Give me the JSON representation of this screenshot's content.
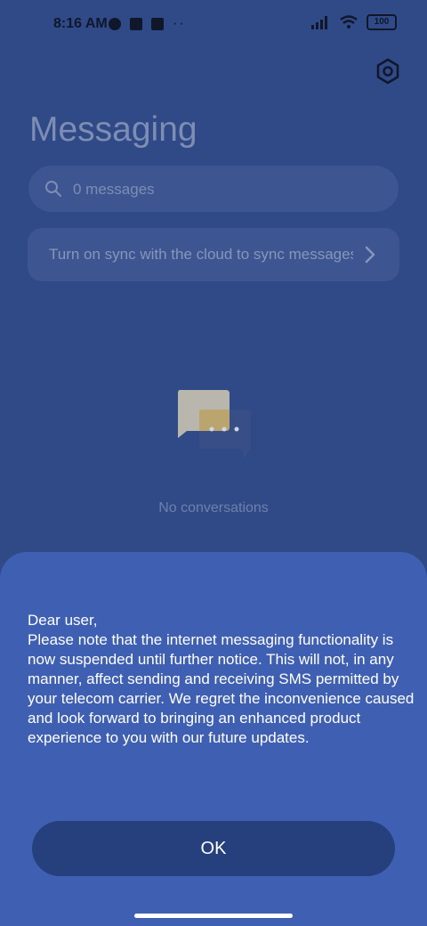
{
  "status": {
    "time": "8:16 AM",
    "battery": "100"
  },
  "header": {
    "title": "Messaging"
  },
  "search": {
    "placeholder": "0 messages"
  },
  "sync_banner": {
    "text": "Turn on sync with the cloud to sync messages"
  },
  "empty_state": {
    "text": "No conversations"
  },
  "dialog": {
    "greeting": "Dear user,",
    "message": "Please note that the internet messaging functionality is now suspended until further notice. This will not, in any manner, affect sending and receiving SMS permitted by your telecom carrier. We regret the inconvenience caused and look forward to bringing an enhanced product experience to you with our future updates.",
    "ok_label": "OK"
  },
  "colors": {
    "background": "#2f4a87",
    "sheet": "#3f60b2",
    "button": "#263f7d"
  },
  "icons": [
    "settings-gear-icon",
    "search-icon",
    "chevron-right-icon",
    "chat-bubbles-icon"
  ]
}
